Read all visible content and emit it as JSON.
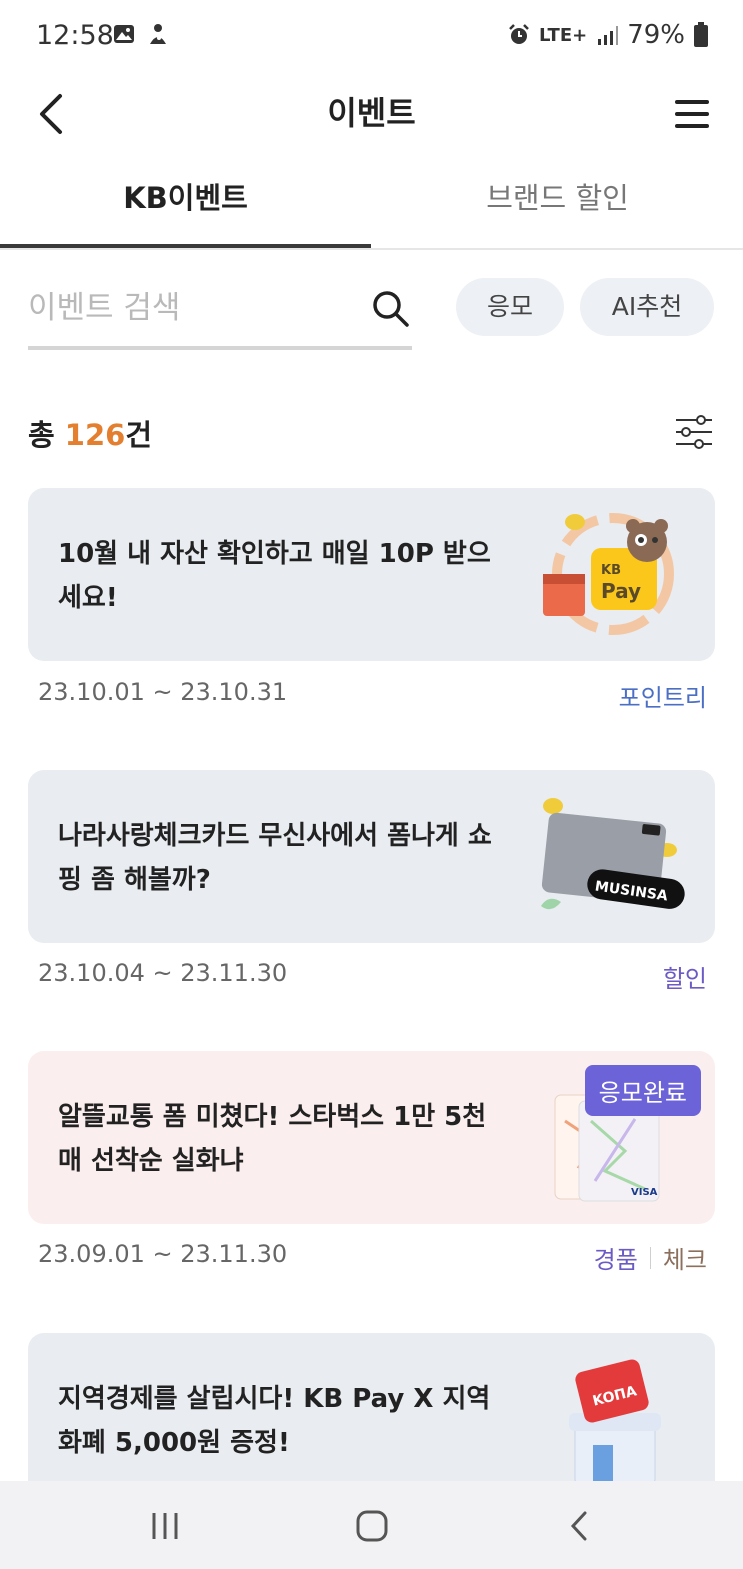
{
  "status_bar": {
    "time": "12:58",
    "network": "LTE+",
    "battery": "79%",
    "icons": [
      "image-icon",
      "figure-icon",
      "alarm-icon",
      "signal-icon",
      "battery-icon"
    ]
  },
  "header": {
    "title": "이벤트",
    "back_icon": "chevron-left-icon",
    "menu_icon": "hamburger-menu-icon"
  },
  "tabs": [
    {
      "label": "KB이벤트",
      "active": true
    },
    {
      "label": "브랜드 할인",
      "active": false
    }
  ],
  "search": {
    "placeholder": "이벤트 검색",
    "value": "",
    "icon": "search-icon"
  },
  "chips": {
    "apply": "응모",
    "ai": "AI추천"
  },
  "summary": {
    "prefix": "총 ",
    "count": "126",
    "suffix": "건",
    "filter_icon": "sliders-icon"
  },
  "events": [
    {
      "title": "10월 내 자산 확인하고 매일 10P 받으세요!",
      "date": "23.10.01 ~ 23.10.31",
      "tags": [
        "포인트리"
      ],
      "art": "kb-pay-bear-calendar-icon"
    },
    {
      "title": "나라사랑체크카드 무신사에서 폼나게 쇼핑 좀 해볼까?",
      "date": "23.10.04 ~ 23.11.30",
      "tags": [
        "할인"
      ],
      "art": "musinsa-card-icon"
    },
    {
      "title": "알뜰교통 폼 미쳤다! 스타벅스 1만 5천매 선착순 실화냐",
      "date": "23.09.01 ~ 23.11.30",
      "tags": [
        "경품",
        "체크"
      ],
      "badge": "응모완료",
      "art": "transit-card-icon"
    },
    {
      "title": "지역경제를 살립시다! KB Pay X 지역화폐 5,000원 증정!",
      "art": "local-shop-icon",
      "art_text": "KOΠA"
    }
  ],
  "colors": {
    "accent_orange": "#e37f2e",
    "badge_purple": "#6c63d8",
    "tag_blue": "#4b6fc4",
    "tag_purple": "#6b5bc4",
    "tag_brown": "#8c6f5c",
    "card_gray": "#e9ecf0",
    "card_pink": "#fbeeee",
    "chip_bg": "#edf0f4"
  },
  "nav_bar": {
    "recent_icon": "recent-apps-icon",
    "home_icon": "home-icon",
    "back_icon": "back-icon"
  }
}
